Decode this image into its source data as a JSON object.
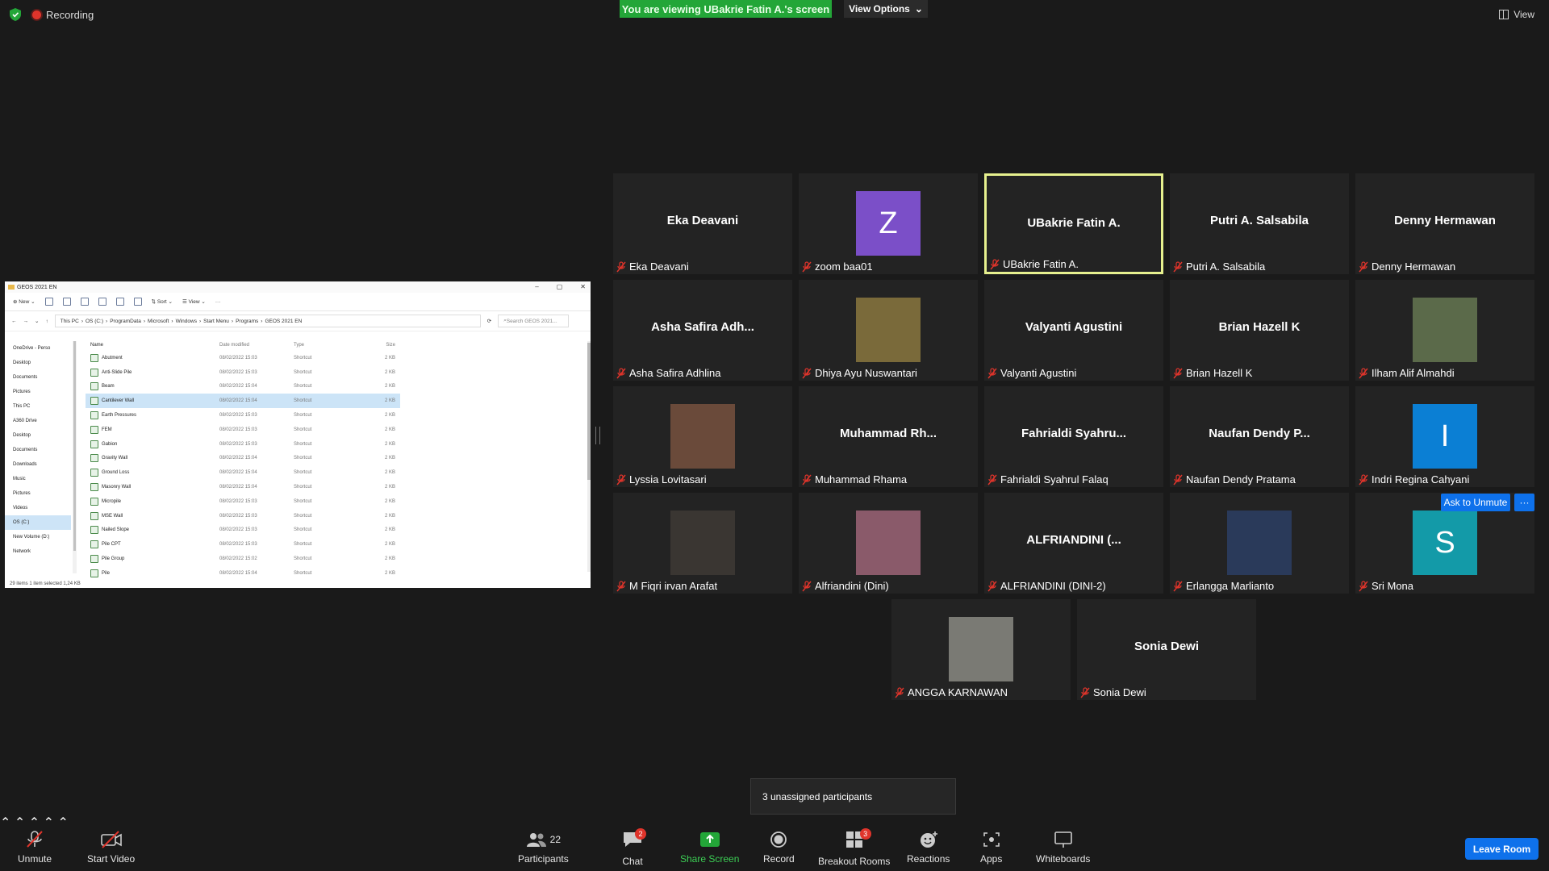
{
  "top": {
    "recording_label": "Recording",
    "viewing_banner": "You are viewing UBakrie Fatin A.'s screen",
    "view_options": "View Options",
    "view_label": "View"
  },
  "share": {
    "window_title": "GEOS 2021 EN",
    "commands": [
      "New",
      "Sort",
      "View"
    ],
    "breadcrumb": [
      "This PC",
      "OS (C:)",
      "ProgramData",
      "Microsoft",
      "Windows",
      "Start Menu",
      "Programs",
      "GEOS 2021 EN"
    ],
    "search_placeholder": "Search GEOS 2021...",
    "nav_items": [
      "OneDrive - Perso",
      "Desktop",
      "Documents",
      "Pictures",
      "This PC",
      "A360 Drive",
      "Desktop",
      "Documents",
      "Downloads",
      "Music",
      "Pictures",
      "Videos",
      "OS (C:)",
      "New Volume (D:)",
      "Network"
    ],
    "columns": [
      "Name",
      "Date modified",
      "Type",
      "Size"
    ],
    "files": [
      [
        "Abutment",
        "08/02/2022 15:03",
        "Shortcut",
        "2 KB"
      ],
      [
        "Anti-Slide Pile",
        "08/02/2022 15:03",
        "Shortcut",
        "2 KB"
      ],
      [
        "Beam",
        "08/02/2022 15:04",
        "Shortcut",
        "2 KB"
      ],
      [
        "Cantilever Wall",
        "08/02/2022 15:04",
        "Shortcut",
        "2 KB"
      ],
      [
        "Earth Pressures",
        "08/02/2022 15:03",
        "Shortcut",
        "2 KB"
      ],
      [
        "FEM",
        "08/02/2022 15:03",
        "Shortcut",
        "2 KB"
      ],
      [
        "Gabion",
        "08/02/2022 15:03",
        "Shortcut",
        "2 KB"
      ],
      [
        "Gravity Wall",
        "08/02/2022 15:04",
        "Shortcut",
        "2 KB"
      ],
      [
        "Ground Loss",
        "08/02/2022 15:04",
        "Shortcut",
        "2 KB"
      ],
      [
        "Masonry Wall",
        "08/02/2022 15:04",
        "Shortcut",
        "2 KB"
      ],
      [
        "Micropile",
        "08/02/2022 15:03",
        "Shortcut",
        "2 KB"
      ],
      [
        "MSE Wall",
        "08/02/2022 15:03",
        "Shortcut",
        "2 KB"
      ],
      [
        "Nailed Slope",
        "08/02/2022 15:03",
        "Shortcut",
        "2 KB"
      ],
      [
        "Pile CPT",
        "08/02/2022 15:03",
        "Shortcut",
        "2 KB"
      ],
      [
        "Pile Group",
        "08/02/2022 15:02",
        "Shortcut",
        "2 KB"
      ],
      [
        "Pile",
        "08/02/2022 15:04",
        "Shortcut",
        "2 KB"
      ]
    ],
    "status": "29 items    1 item selected  1,24 KB"
  },
  "participants": [
    {
      "center": "Eka Deavani",
      "name": "Eka Deavani"
    },
    {
      "avatar": "Z",
      "avatar_color": "#7b4fc8",
      "name": "zoom baa01"
    },
    {
      "center": "UBakrie Fatin A.",
      "name": "UBakrie Fatin A."
    },
    {
      "center": "Putri A. Salsabila",
      "name": "Putri A. Salsabila"
    },
    {
      "center": "Denny Hermawan",
      "name": "Denny Hermawan"
    },
    {
      "center": "Asha Safira Adh...",
      "name": "Asha Safira Adhlina"
    },
    {
      "photo": "#7a6a3a",
      "name": "Dhiya Ayu Nuswantari"
    },
    {
      "center": "Valyanti Agustini",
      "name": "Valyanti Agustini"
    },
    {
      "center": "Brian Hazell K",
      "name": "Brian Hazell K"
    },
    {
      "photo": "#5b6a4a",
      "name": "Ilham Alif Almahdi"
    },
    {
      "photo": "#6a4a3a",
      "name": "Lyssia Lovitasari"
    },
    {
      "center": "Muhammad Rh...",
      "name": "Muhammad Rhama"
    },
    {
      "center": "Fahrialdi Syahru...",
      "name": "Fahrialdi Syahrul Falaq"
    },
    {
      "center": "Naufan Dendy P...",
      "name": "Naufan Dendy Pratama"
    },
    {
      "avatar": "I",
      "avatar_color": "#0b7fd4",
      "name": "Indri Regina Cahyani"
    },
    {
      "photo": "#3a3632",
      "name": "M Fiqri irvan Arafat"
    },
    {
      "photo": "#8a5a6a",
      "name": "Alfriandini (Dini)"
    },
    {
      "center": "ALFRIANDINI (...",
      "name": "ALFRIANDINI (DINI-2)"
    },
    {
      "photo": "#2a3a5a",
      "name": "Erlangga Marlianto"
    },
    {
      "avatar": "S",
      "avatar_color": "#139aa8",
      "name": "Sri Mona"
    },
    {
      "photo": "#7a7a74",
      "name": "ANGGA KARNAWAN"
    },
    {
      "center": "Sonia Dewi",
      "name": "Sonia Dewi"
    }
  ],
  "ask_to_unmute": "Ask to Unmute",
  "more_label": "···",
  "tooltip": "3 unassigned participants",
  "toolbar": {
    "unmute": "Unmute",
    "start_video": "Start Video",
    "participants": "Participants",
    "participants_count": "22",
    "chat": "Chat",
    "chat_badge": "2",
    "share_screen": "Share Screen",
    "record": "Record",
    "breakout_rooms": "Breakout Rooms",
    "breakout_badge": "3",
    "reactions": "Reactions",
    "apps": "Apps",
    "whiteboards": "Whiteboards",
    "leave_room": "Leave Room"
  }
}
